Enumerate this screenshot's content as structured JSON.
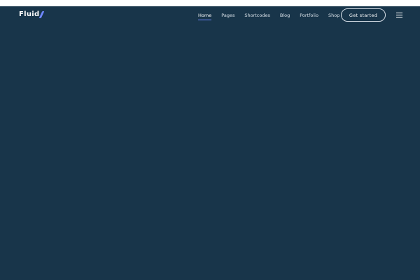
{
  "header": {
    "logo_text": "Fluid",
    "nav": [
      {
        "label": "Home",
        "active": true
      },
      {
        "label": "Pages",
        "active": false
      },
      {
        "label": "Shortcodes",
        "active": false
      },
      {
        "label": "Blog",
        "active": false
      },
      {
        "label": "Portfolio",
        "active": false
      },
      {
        "label": "Shop",
        "active": false
      }
    ],
    "cta_label": "Get started",
    "menu_icon": "hamburger-menu-icon"
  },
  "colors": {
    "background": "#18354a",
    "accent": "#6f87ff",
    "text": "#ffffff"
  }
}
